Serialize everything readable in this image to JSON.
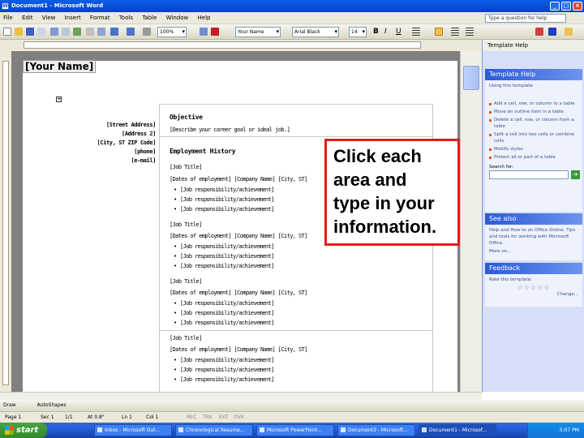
{
  "window": {
    "title": "Document1 - Microsoft Word",
    "buttons": [
      "_",
      "□",
      "×"
    ]
  },
  "menu": {
    "items": [
      "File",
      "Edit",
      "View",
      "Insert",
      "Format",
      "Tools",
      "Table",
      "Window",
      "Help"
    ],
    "help_placeholder": "Type a question for help"
  },
  "toolbar": {
    "style": "Title",
    "font": "Your Name",
    "font2": "Arial Black",
    "size": "14",
    "zoom": "100%"
  },
  "document": {
    "name": "[Your Name]",
    "address": [
      "[Street Address]",
      "[Address 2]",
      "[City, ST ZIP Code]",
      "[phone]",
      "[e-mail]"
    ],
    "objective_heading": "Objective",
    "objective_text": "[Describe your career goal or ideal job.]",
    "employment_heading": "Employment History",
    "jobs": [
      {
        "title": "[Job Title]",
        "details": "[Dates of employment]  [Company Name]  [City, ST]",
        "items": [
          "[Job responsibility/achievement]",
          "[Job responsibility/achievement]",
          "[Job responsibility/achievement]"
        ]
      },
      {
        "title": "[Job Title]",
        "details": "[Dates of employment]  [Company Name]  [City, ST]",
        "items": [
          "[Job responsibility/achievement]",
          "[Job responsibility/achievement]",
          "[Job responsibility/achievement]"
        ]
      },
      {
        "title": "[Job Title]",
        "details": "[Dates of employment]  [Company Name]  [City, ST]",
        "items": [
          "[Job responsibility/achievement]",
          "[Job responsibility/achievement]",
          "[Job responsibility/achievement]"
        ]
      },
      {
        "title": "[Job Title]",
        "details": "[Dates of employment]  [Company Name]  [City, ST]",
        "items": [
          "[Job responsibility/achievement]",
          "[Job responsibility/achievement]",
          "[Job responsibility/achievement]"
        ]
      }
    ]
  },
  "callout": {
    "lines": [
      "Click each",
      "area and",
      "type in your",
      "information."
    ]
  },
  "taskpane": {
    "title": "Template Help",
    "section1": "Template Help",
    "section1_intro": "Using this template",
    "section1_items": [
      "Add a cell, row, or column to a table",
      "Move an outline item in a table",
      "Delete a cell, row, or column from a table",
      "Split a cell into two cells or combine cells",
      "Modify styles",
      "Protect all or part of a table"
    ],
    "search_label": "Search for:",
    "section2": "See also",
    "section2_text": "Help and How-to on Office Online. Tips and tools for working with Microsoft Office.",
    "section2_link": "More on...",
    "section3": "Feedback",
    "section3_text": "Rate this template:",
    "section3_link": "Change...",
    "rating_stars": 5
  },
  "drawbar": {
    "draw": "Draw",
    "autoshapes": "AutoShapes"
  },
  "status": {
    "page": "Page 1",
    "sec": "Sec 1",
    "pos": "1/1",
    "at": "At 0.8\"",
    "ln": "Ln 1",
    "col": "Col 1",
    "rec": "REC",
    "trk": "TRK",
    "ext": "EXT",
    "ovr": "OVR"
  },
  "taskbar": {
    "start": "start",
    "tasks": [
      "Inbox - Microsoft Out...",
      "Chronological Resume...",
      "Microsoft PowerPoint...",
      "Document3 - Microsoft...",
      "Document1 - Microsof..."
    ],
    "clock": "5:07 PM"
  },
  "colors": {
    "accent": "#0a5ee8",
    "callout_border": "#e21b1b",
    "pane": "#d6dff7"
  }
}
